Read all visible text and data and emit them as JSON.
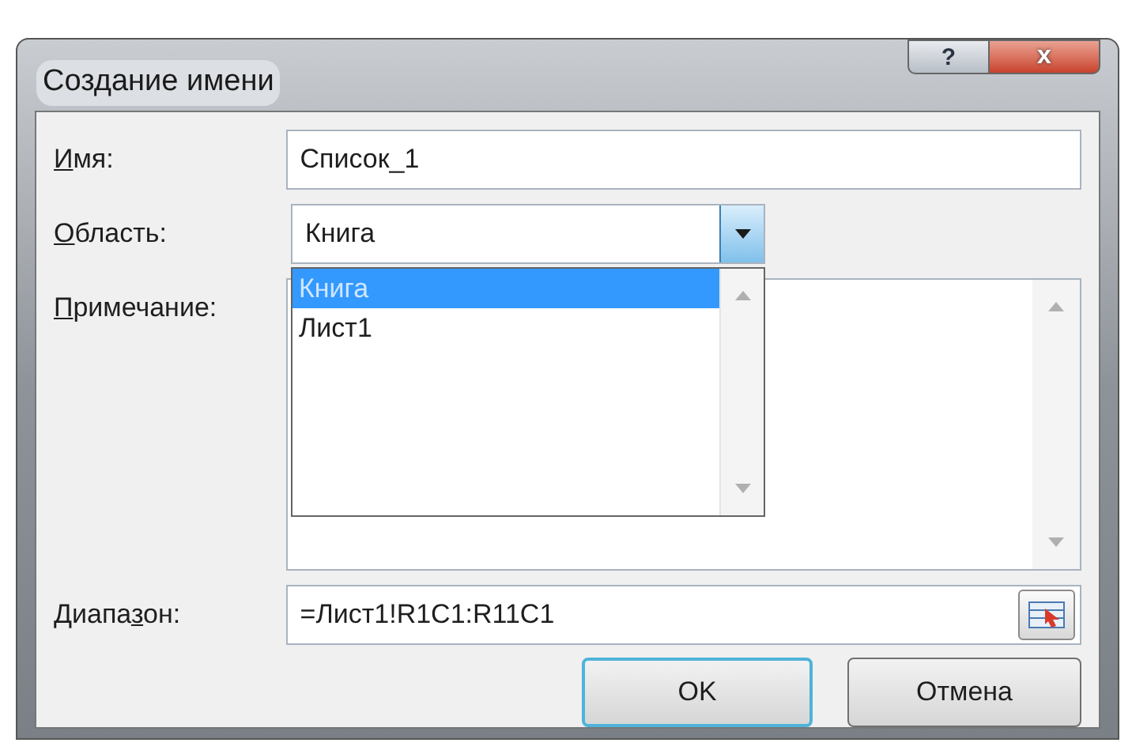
{
  "window": {
    "title": "Создание имени",
    "help": "?",
    "close": "x"
  },
  "fields": [
    {
      "kind": "text",
      "label": {
        "key": "И",
        "after": "мя:"
      },
      "value": "Список_1"
    },
    {
      "kind": "combo",
      "label": {
        "key": "О",
        "after": "бласть:"
      },
      "value": "Книга",
      "expanded": true,
      "options": [
        {
          "label": "Книга",
          "selected": true
        },
        {
          "label": "Лист1",
          "selected": false
        }
      ]
    },
    {
      "kind": "memo",
      "label": {
        "key": "П",
        "after": "римечание:"
      }
    },
    {
      "kind": "range",
      "label": {
        "before": "Диапа",
        "key": "з",
        "after": "он:"
      },
      "value": "=Лист1!R1C1:R11C1"
    }
  ],
  "buttons": [
    {
      "label": "OK",
      "default": true
    },
    {
      "label": "Отмена",
      "default": false
    }
  ]
}
